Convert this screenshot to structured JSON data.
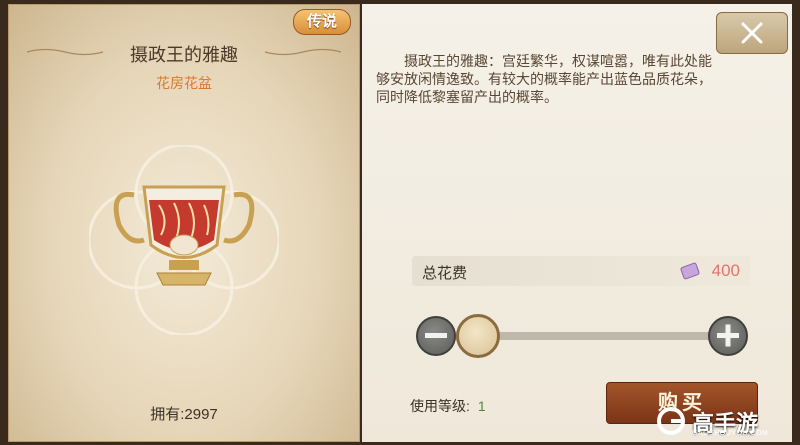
{
  "item": {
    "rarity_badge": "传说",
    "name": "摄政王的雅趣",
    "category": "花房花盆",
    "owned_label": "拥有:2997"
  },
  "detail": {
    "description": "摄政王的雅趣：宫廷繁华，权谋喧嚣，唯有此处能够安放闲情逸致。有较大的概率能产出蓝色品质花朵，同时降低黎塞留产出的概率。",
    "cost_label": "总花费",
    "cost_value": "400",
    "cost_icon": "ticket-icon",
    "level_label": "使用等级:",
    "level_value": "1",
    "buy_label": "购买",
    "quantity_fraction": 0
  },
  "watermark": {
    "brand": "高手游",
    "domain": "GAOSHOUYOU.COM"
  },
  "colors": {
    "accent_orange": "#d77a2e",
    "cost_red": "#e07470",
    "level_green": "#4a8a3a",
    "buy_brown": "#8c3f1f"
  }
}
